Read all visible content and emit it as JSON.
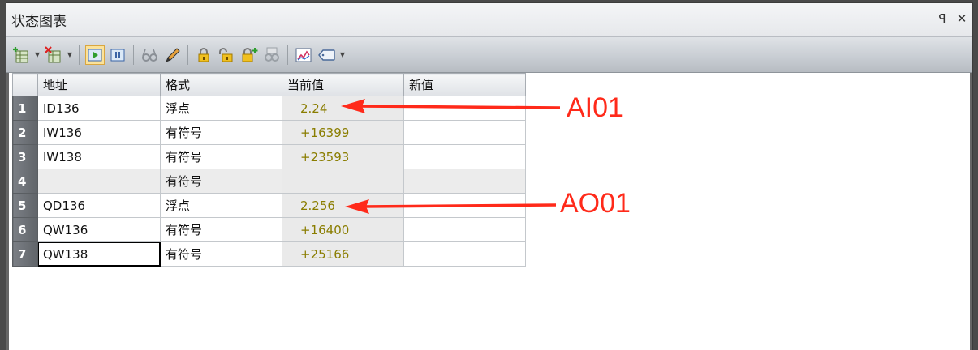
{
  "window": {
    "title": "状态图表",
    "pin_glyph": "ꟼ",
    "close_glyph": "✕"
  },
  "table": {
    "columns": [
      "地址",
      "格式",
      "当前值",
      "新值"
    ],
    "rows": [
      {
        "num": "1",
        "address": "ID136",
        "format": "浮点",
        "current": "2.24",
        "new": ""
      },
      {
        "num": "2",
        "address": "IW136",
        "format": "有符号",
        "current": "+16399",
        "new": ""
      },
      {
        "num": "3",
        "address": "IW138",
        "format": "有符号",
        "current": "+23593",
        "new": ""
      },
      {
        "num": "4",
        "address": "",
        "format": "有符号",
        "current": "",
        "new": ""
      },
      {
        "num": "5",
        "address": "QD136",
        "format": "浮点",
        "current": "2.256",
        "new": ""
      },
      {
        "num": "6",
        "address": "QW136",
        "format": "有符号",
        "current": "+16400",
        "new": ""
      },
      {
        "num": "7",
        "address": "QW138",
        "format": "有符号",
        "current": "+25166",
        "new": ""
      }
    ]
  },
  "annotations": {
    "ai": "AI01",
    "ao": "AO01",
    "color": "#ff2a1a"
  },
  "toolbar_icons": [
    "insert-row-icon",
    "delete-row-icon",
    "chart-status-icon",
    "pause-icon",
    "glasses-icon",
    "pencil-icon",
    "lock-icon",
    "unlock-icon",
    "force-icon",
    "read-all-icon",
    "trend-icon",
    "tag-icon"
  ]
}
